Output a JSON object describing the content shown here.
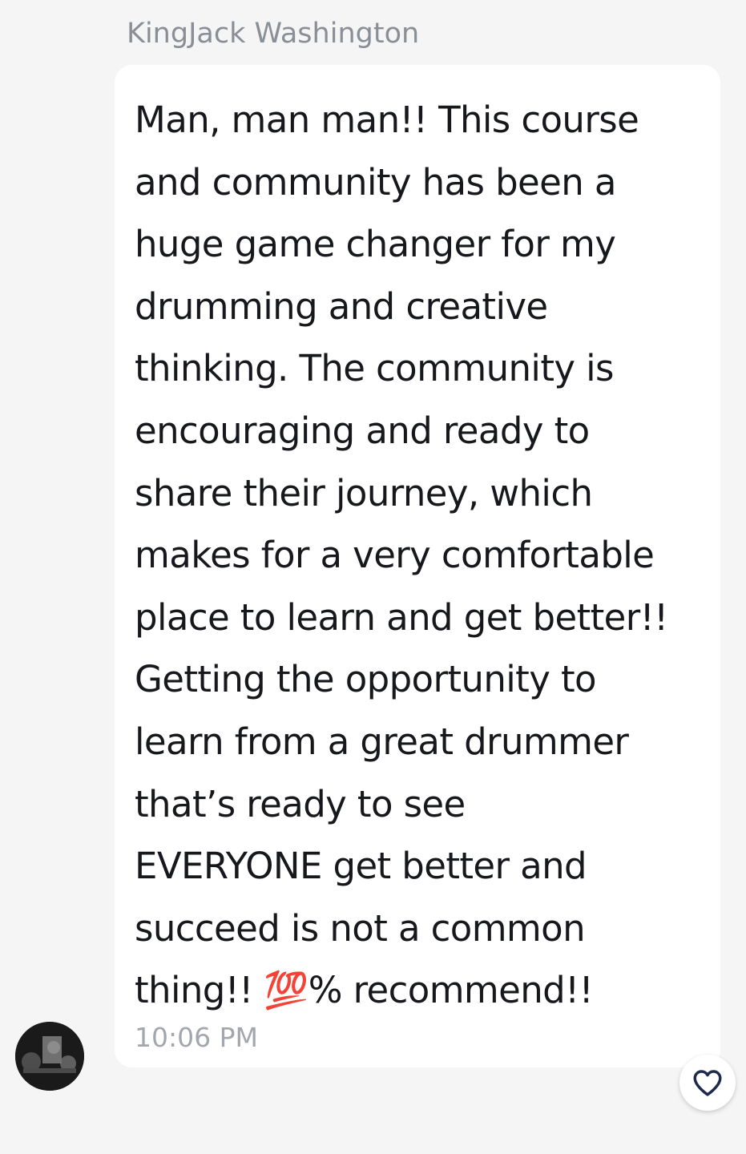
{
  "message": {
    "sender_name": "KingJack Washington",
    "text_lines": [
      "Man, man man!! This course",
      "and community has been a",
      "huge game changer for my",
      "drumming and creative",
      "thinking. The community is",
      "encouraging and ready to",
      "share their journey, which",
      "makes for a very comfortable",
      "place to learn and get better!!",
      "Getting the opportunity to",
      "learn from a great drummer",
      "that’s ready to see",
      "EVERYONE get better and",
      "succeed is not a common",
      "thing!! 💯% recommend!!"
    ],
    "timestamp": "10:06 PM"
  },
  "icons": {
    "avatar": "avatar-photo",
    "like": "heart-icon"
  },
  "colors": {
    "background": "#f5f5f6",
    "bubble": "#ffffff",
    "text": "#16181c",
    "muted": "#8a8f97",
    "heart": "#1f2a4f"
  }
}
